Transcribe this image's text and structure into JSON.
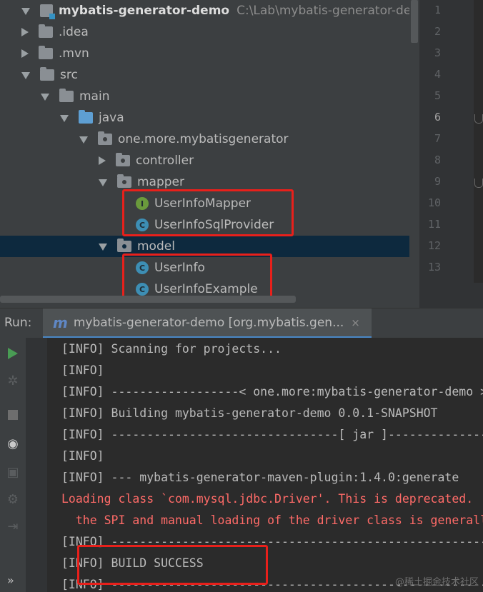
{
  "project_tree": {
    "root": {
      "label": "mybatis-generator-demo",
      "path": "C:\\Lab\\mybatis-generator-demo"
    },
    "items": [
      {
        "label": ".idea",
        "expanded": false
      },
      {
        "label": ".mvn",
        "expanded": false
      },
      {
        "label": "src",
        "expanded": true
      },
      {
        "label": "main",
        "expanded": true
      },
      {
        "label": "java",
        "expanded": true
      },
      {
        "label": "one.more.mybatisgenerator",
        "expanded": true
      },
      {
        "label": "controller",
        "expanded": false
      },
      {
        "label": "mapper",
        "expanded": true
      },
      {
        "label": "UserInfoMapper",
        "icon_letter": "I"
      },
      {
        "label": "UserInfoSqlProvider",
        "icon_letter": "C"
      },
      {
        "label": "model",
        "expanded": true
      },
      {
        "label": "UserInfo",
        "icon_letter": "C"
      },
      {
        "label": "UserInfoExample",
        "icon_letter": "C"
      }
    ],
    "highlight_color": "#e8201b"
  },
  "editor": {
    "line_numbers": [
      "1",
      "2",
      "3",
      "4",
      "5",
      "6",
      "7",
      "8",
      "9",
      "10",
      "11",
      "12",
      "13"
    ],
    "current_line": "6"
  },
  "run_window": {
    "label": "Run:",
    "tab": {
      "icon": "m",
      "title": "mybatis-generator-demo [org.mybatis.gen...",
      "close": "×"
    },
    "console_lines": [
      {
        "text": "[INFO] Scanning for projects...",
        "type": "info"
      },
      {
        "text": "[INFO]",
        "type": "info"
      },
      {
        "text": "[INFO] ------------------< one.more:mybatis-generator-demo >------------------",
        "type": "info"
      },
      {
        "text": "[INFO] Building mybatis-generator-demo 0.0.1-SNAPSHOT",
        "type": "info"
      },
      {
        "text": "[INFO] --------------------------------[ jar ]---------------------------------",
        "type": "info"
      },
      {
        "text": "[INFO]",
        "type": "info"
      },
      {
        "text": "[INFO] --- mybatis-generator-maven-plugin:1.4.0:generate",
        "type": "info"
      },
      {
        "text": "Loading class `com.mysql.jdbc.Driver'. This is deprecated.",
        "type": "error"
      },
      {
        "text": "  the SPI and manual loading of the driver class is generally unnecessary.",
        "type": "error"
      },
      {
        "text": "[INFO] ------------------------------------------------------------------------",
        "type": "info"
      },
      {
        "text": "[INFO] BUILD SUCCESS",
        "type": "info"
      },
      {
        "text": "[INFO] ------------------------------------------------------------------------",
        "type": "info"
      }
    ],
    "chevrons": "»"
  },
  "watermark": "@稀土掘金技术社区"
}
